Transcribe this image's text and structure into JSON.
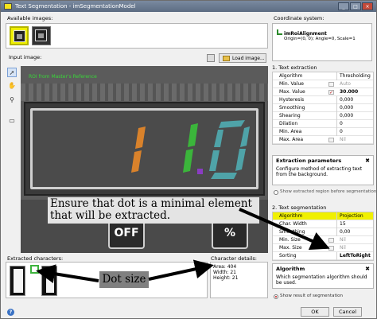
{
  "window": {
    "title": "Text Segmentation - imSegmentationModel",
    "controls": [
      "_",
      "□",
      "×"
    ]
  },
  "available_images": {
    "label": "Available images:"
  },
  "coordinate_system": {
    "label": "Coordinate system:",
    "name": "imRoiAlignment",
    "origin": "Origin=(0, 0); Angle=0, Scale=1"
  },
  "input_image": {
    "label": "Input image:",
    "load_button": "Load image...",
    "roi_label": "ROI from Master's Reference",
    "callout": "Ensure that dot is a minimal element that will be extracted.",
    "keys": [
      "OFF",
      "%"
    ]
  },
  "toolbar": {
    "icons": [
      "arrow-pointer-icon",
      "hand-pan-icon",
      "zoom-icon",
      "fit-icon"
    ]
  },
  "extracted": {
    "label": "Extracted characters:",
    "dot_size_label": "Dot size"
  },
  "details": {
    "label": "Character details:",
    "area": "Area: 404",
    "width": "Width: 21",
    "height": "Height: 21"
  },
  "text_extraction": {
    "heading": "1. Text extraction",
    "rows": [
      {
        "key": "Algorithm",
        "value": "Thresholding"
      },
      {
        "key": "Min. Value",
        "value": "Auto"
      },
      {
        "key": "Max. Value",
        "value": "30.000"
      },
      {
        "key": "Hysteresis",
        "value": "0,000"
      },
      {
        "key": "Smoothing",
        "value": "0,000"
      },
      {
        "key": "Shearing",
        "value": "0,000"
      },
      {
        "key": "Dilation",
        "value": "0"
      },
      {
        "key": "Min. Area",
        "value": "0"
      },
      {
        "key": "Max. Area",
        "value": "Nil"
      }
    ],
    "desc_title": "Extraction parameters",
    "desc_text": "Configure method of extracting text from the background.",
    "show_region": "Show extracted region before segmentation"
  },
  "text_segmentation": {
    "heading": "2. Text segmentation",
    "header_key": "Algorithm",
    "header_value": "Projection",
    "rows": [
      {
        "key": "Char. Width",
        "value": "15"
      },
      {
        "key": "Smoothing",
        "value": "0,00"
      },
      {
        "key": "Min. Size",
        "value": "Nil"
      },
      {
        "key": "Max. Size",
        "value": "Nil"
      },
      {
        "key": "Sorting",
        "value": "LeftToRight"
      }
    ],
    "desc_title": "Algorithm",
    "desc_text": "Which segmentation algorithm should be used.",
    "show_result": "Show result of segmentation"
  },
  "buttons": {
    "ok": "OK",
    "cancel": "Cancel",
    "help": "?"
  },
  "colors": {
    "highlight": "#f0f000",
    "digit_orange": "#d9822b",
    "digit_green": "#3bb53b",
    "digit_teal": "#4fa3a8",
    "dot_purple": "#8a3cc2"
  }
}
